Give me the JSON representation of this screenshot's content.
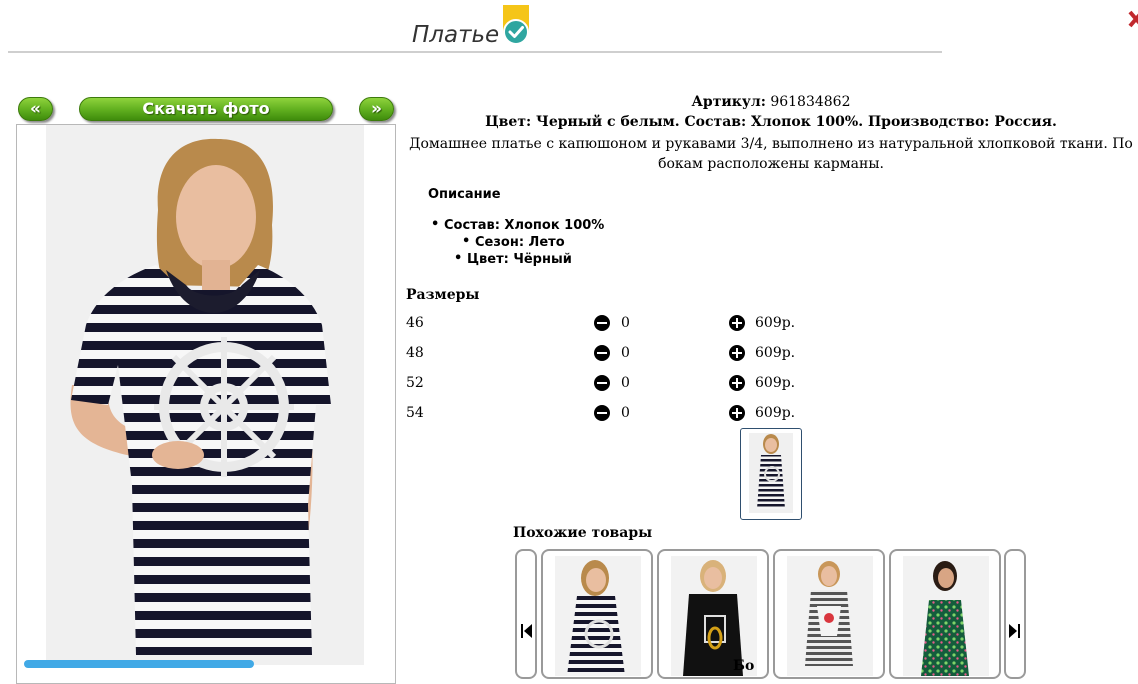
{
  "product": {
    "title": "Платье",
    "article_label": "Артикул:",
    "article_value": " 961834862",
    "specs": "Цвет: Черный с белым. Состав: Хлопок 100%. Производство: Россия.",
    "description": "Домашнее платье с капюшоном и рукавами 3/4, выполнено из натуральной хлопковой ткани. По бокам расположены карманы."
  },
  "gallery": {
    "prev_label": "«",
    "download_label": "Скачать фото",
    "next_label": "»"
  },
  "details": {
    "heading": "Описание",
    "props": [
      "Состав: Хлопок 100%",
      "Сезон: Лето",
      "Цвет: Чёрный"
    ]
  },
  "sizes": {
    "heading": "Размеры",
    "rows": [
      {
        "size": "46",
        "qty": "0",
        "price": "609р."
      },
      {
        "size": "48",
        "qty": "0",
        "price": "609р."
      },
      {
        "size": "52",
        "qty": "0",
        "price": "609р."
      },
      {
        "size": "54",
        "qty": "0",
        "price": "609р."
      }
    ]
  },
  "similar": {
    "heading": "Похожие товары",
    "cut_text": "Бо"
  },
  "colors": {
    "button_green": "#5fae1e",
    "badge_yellow": "#f5c518",
    "check_teal": "#2fa6a0",
    "accent_blue": "#41a9e6"
  },
  "icons": [
    "verified-check-icon",
    "close-icon",
    "minus-circle-icon",
    "plus-circle-icon",
    "skip-prev-icon",
    "skip-next-icon"
  ]
}
